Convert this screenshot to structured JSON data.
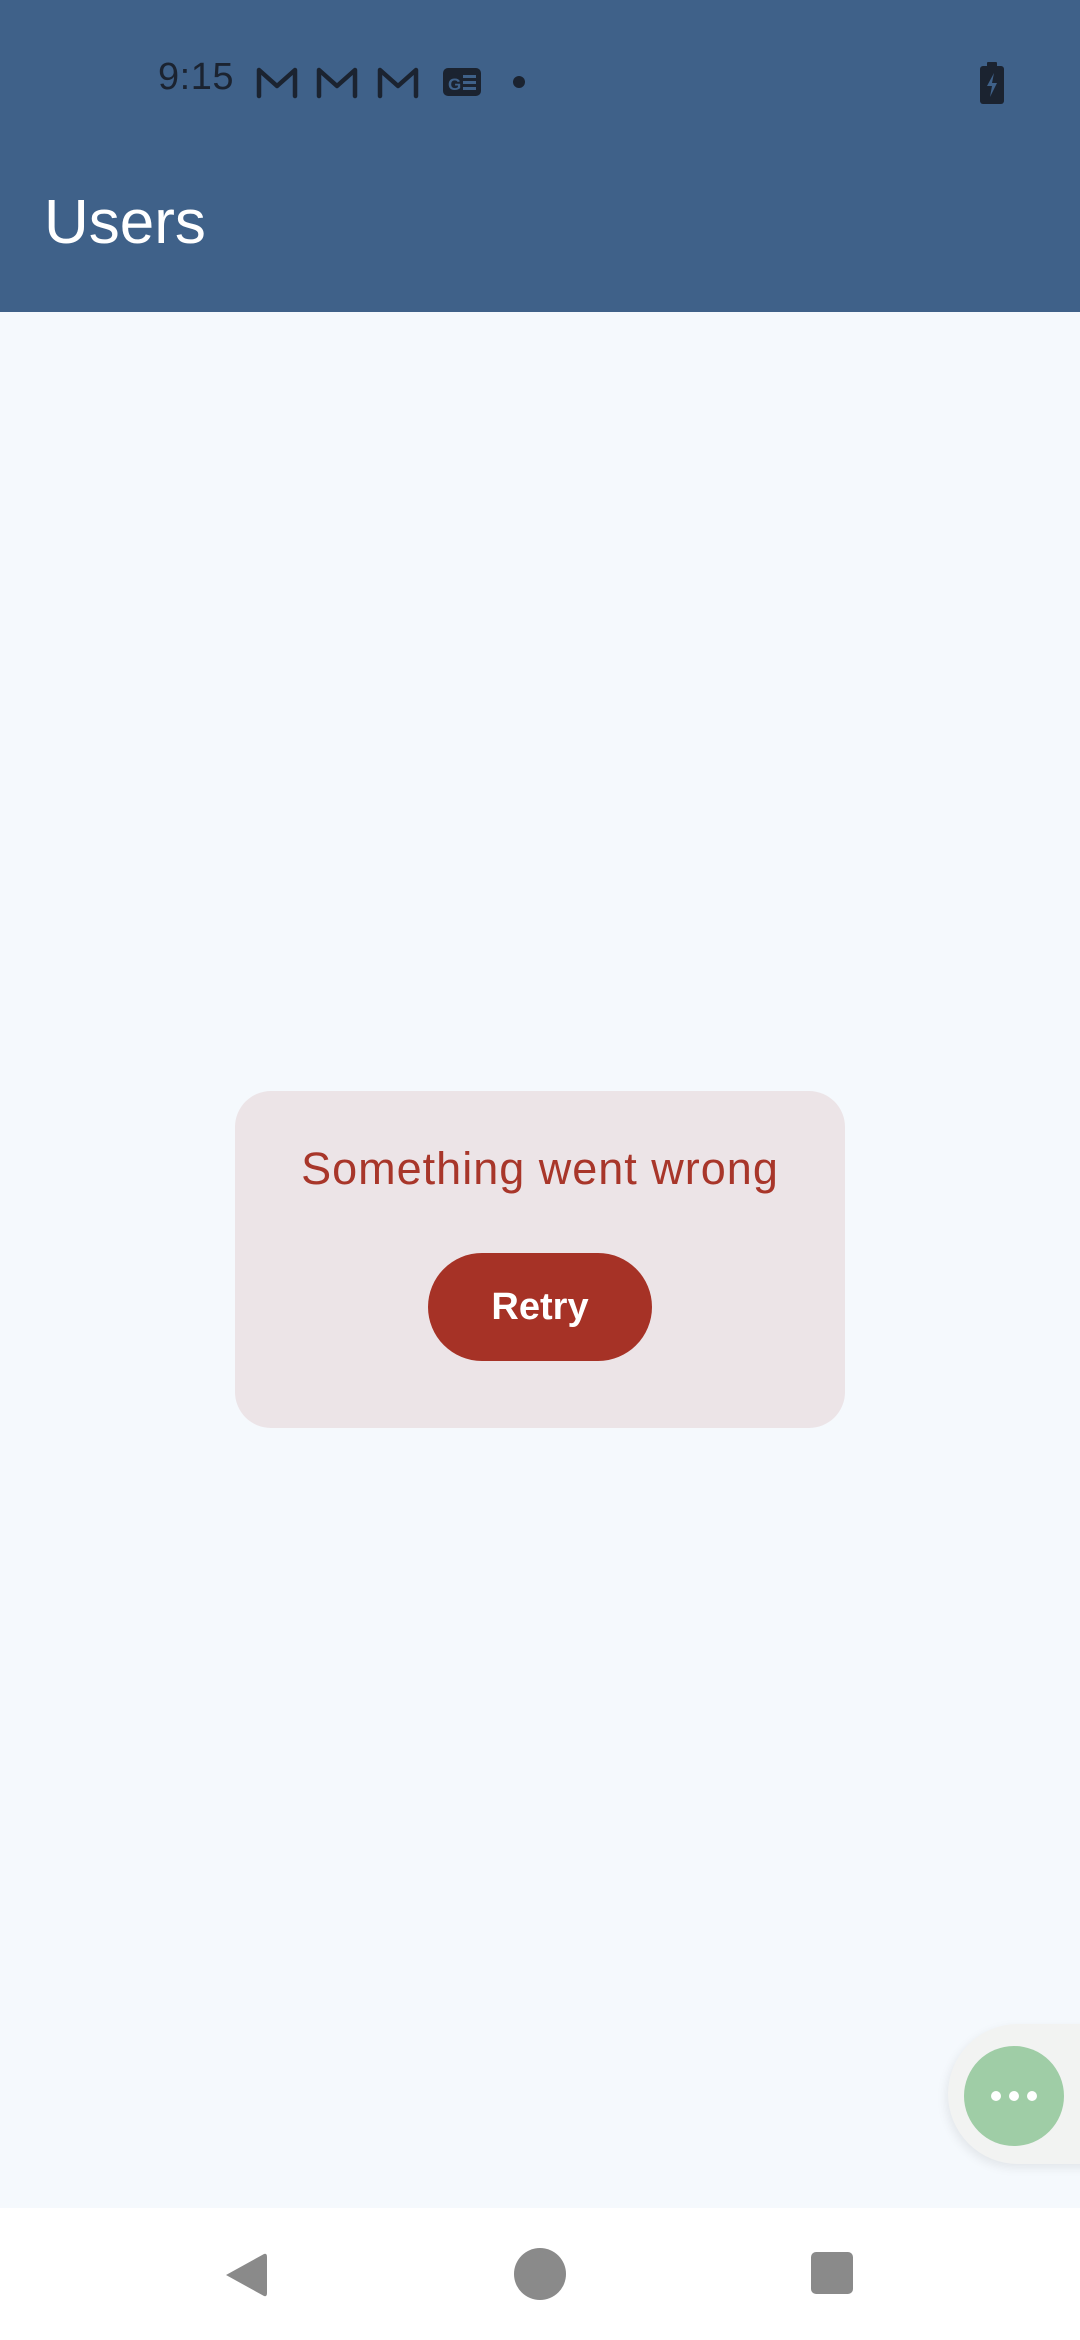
{
  "status_bar": {
    "time": "9:15",
    "icons": [
      "gmail-icon",
      "gmail-icon",
      "gmail-icon",
      "news-icon",
      "dot-icon",
      "battery-charging-icon"
    ]
  },
  "app_bar": {
    "title": "Users"
  },
  "error_card": {
    "message": "Something went wrong",
    "retry_label": "Retry"
  },
  "fab": {
    "icon": "more-horizontal-icon"
  },
  "nav_bar": {
    "icons": [
      "back-icon",
      "home-icon",
      "recents-icon"
    ]
  },
  "colors": {
    "header": "#3f6189",
    "background": "#f5f9fd",
    "card": "#ece4e7",
    "error_text": "#a8362a",
    "retry_button": "#a63226",
    "fab": "#9fcda6"
  }
}
